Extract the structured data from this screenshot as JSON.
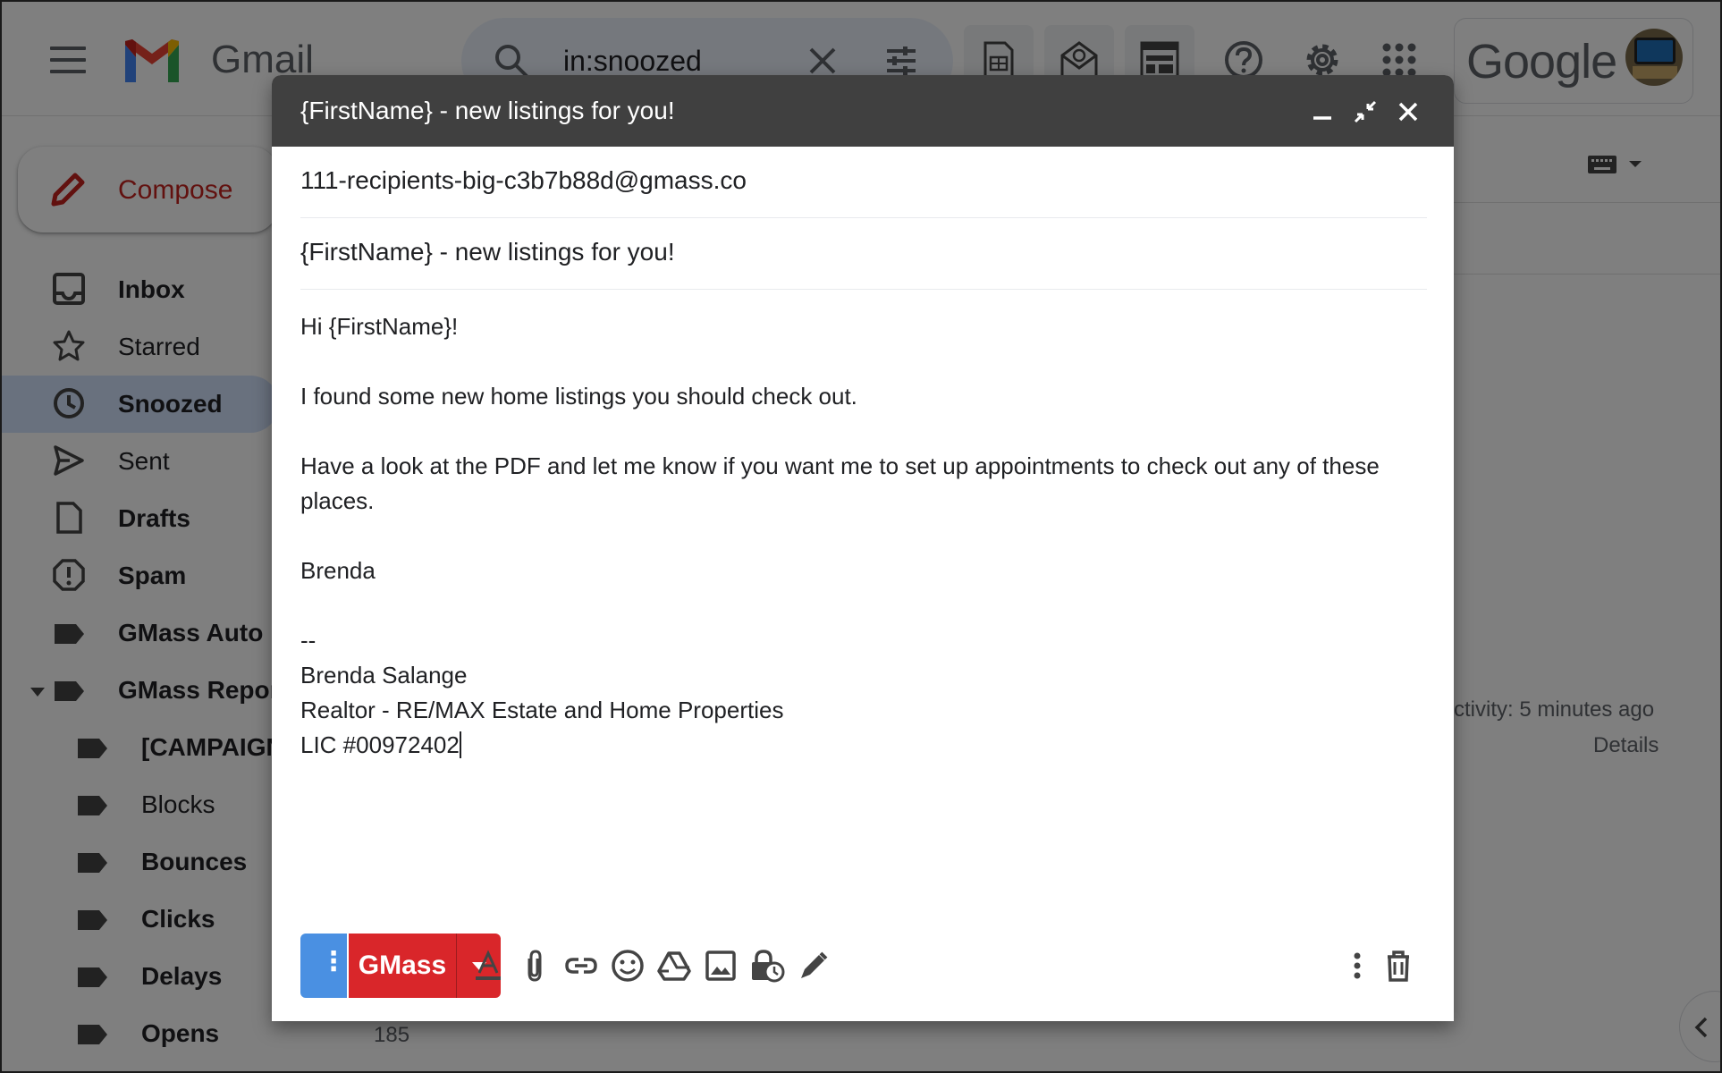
{
  "app": {
    "name": "Gmail",
    "brand_word": "Google",
    "search_query": "in:snoozed"
  },
  "sidebar": {
    "compose_label": "Compose",
    "items": [
      {
        "label": "Inbox",
        "bold": true
      },
      {
        "label": "Starred",
        "bold": false
      },
      {
        "label": "Snoozed",
        "bold": true
      },
      {
        "label": "Sent",
        "bold": false
      },
      {
        "label": "Drafts",
        "bold": true
      },
      {
        "label": "Spam",
        "bold": true
      },
      {
        "label": "GMass Auto F",
        "bold": true
      },
      {
        "label": "GMass Repor",
        "bold": true
      },
      {
        "label": "[CAMPAIGN",
        "bold": true
      },
      {
        "label": "Blocks",
        "bold": false
      },
      {
        "label": "Bounces",
        "bold": true
      },
      {
        "label": "Clicks",
        "bold": true
      },
      {
        "label": "Delays",
        "bold": true
      },
      {
        "label": "Opens",
        "bold": true
      }
    ],
    "opens_count": "185"
  },
  "background_list": {
    "activity_text": "ctivity: 5 minutes ago",
    "details_label": "Details"
  },
  "compose": {
    "title": "{FirstName} - new listings for you!",
    "to": "111-recipients-big-c3b7b88d@gmass.co",
    "subject": "{FirstName} - new listings for you!",
    "body_lines": [
      "Hi {FirstName}!",
      "",
      "I found some new home listings you should check out.",
      "",
      "Have a look at the PDF and let me know if you want me to set up appointments to check out any of these places.",
      "",
      "Brenda",
      "",
      "--",
      "Brenda Salange",
      "Realtor - RE/MAX Estate and Home Properties",
      "LIC #00972402"
    ],
    "send_button_label": "GMass",
    "send_more_label": "⋮"
  },
  "colors": {
    "header_bg": "#404040",
    "gmass_red": "#d9262a",
    "options_blue": "#4a90e2",
    "compose_red": "#c5221f",
    "snoozed_highlight": "#d3e3fd"
  }
}
